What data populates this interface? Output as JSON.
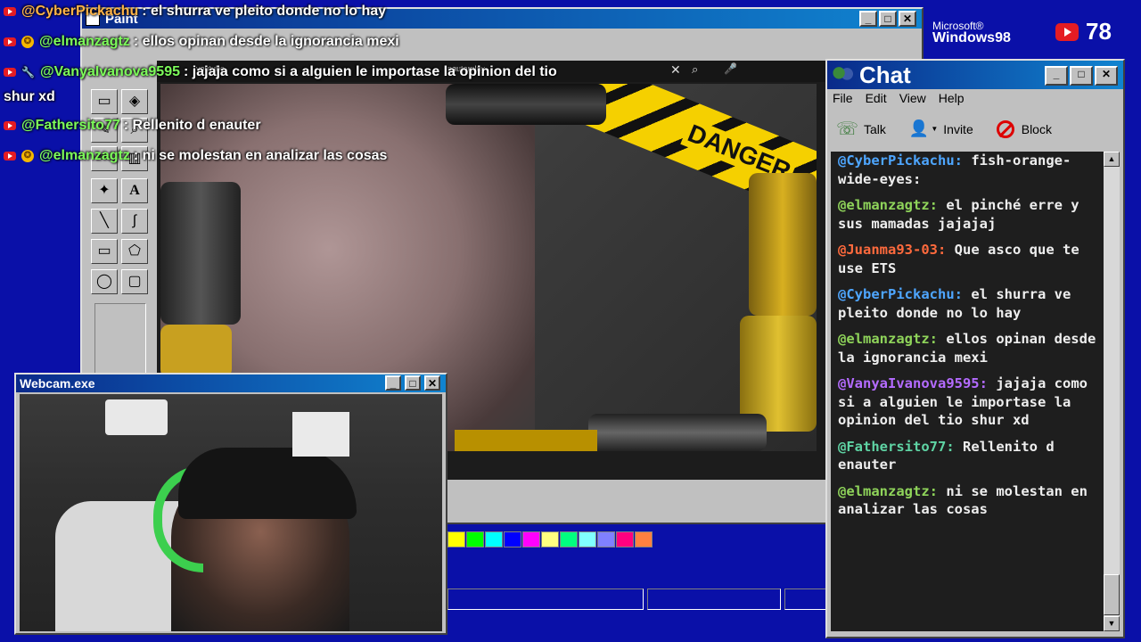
{
  "overlay_chat": [
    {
      "user": "@CyberPickachu",
      "text": ": el shurra ve pleito donde no lo hay",
      "badge": "yt",
      "color": "#ffb347"
    },
    {
      "user": "@elmanzagtz",
      "text": ": ellos opinan desde la ignorancia mexi",
      "badge": "yt-star",
      "color": "#7CFC5A"
    },
    {
      "user": "@VanyaIvanova9595",
      "text": ": jajaja como si a alguien le importase la opinion del tio",
      "badge": "yt-wrench",
      "color": "#7CFC5A"
    },
    {
      "user": "",
      "text": "shur xd",
      "badge": "",
      "color": "#ffffff"
    },
    {
      "user": "@Fathersito77",
      "text": ": Rellenito d enauter",
      "badge": "yt",
      "color": "#7CFC5A"
    },
    {
      "user": "@elmanzagtz",
      "text": ": ni se molestan en analizar las cosas",
      "badge": "yt-star",
      "color": "#7CFC5A"
    }
  ],
  "branding": {
    "os_logo_top": "Microsoft®",
    "os_logo_bottom": "Windows98",
    "viewer_count": "78"
  },
  "paint": {
    "title": "Paint",
    "video_tab_left": "youtube",
    "video_tab_right": "nauterplay",
    "danger_label": "DANGER",
    "palette_colors": [
      "#ffff00",
      "#00ff00",
      "#00ffff",
      "#0000ff",
      "#ff00ff",
      "#ffff80",
      "#00ff80",
      "#80ffff",
      "#8080ff",
      "#ff0080",
      "#ff8040"
    ]
  },
  "webcam": {
    "title": "Webcam.exe"
  },
  "chat": {
    "title": "Chat",
    "menu": [
      "File",
      "Edit",
      "View",
      "Help"
    ],
    "toolbar": {
      "talk": "Talk",
      "invite": "Invite",
      "block": "Block"
    },
    "messages": [
      {
        "user": "@CyberPickachu:",
        "text": "fish-orange-wide-eyes:",
        "color": "#4ea6ff"
      },
      {
        "user": "@elmanzagtz:",
        "text": "el pinché erre y sus mamadas jajajaj",
        "color": "#8fd45a"
      },
      {
        "user": "@Juanma93-03:",
        "text": "Que asco que te use ETS",
        "color": "#ff6a3d"
      },
      {
        "user": "@CyberPickachu:",
        "text": "el shurra ve pleito donde no lo hay",
        "color": "#4ea6ff"
      },
      {
        "user": "@elmanzagtz:",
        "text": "ellos opinan desde la ignorancia mexi",
        "color": "#8fd45a"
      },
      {
        "user": "@VanyaIvanova9595:",
        "text": "jajaja como si a alguien le importase la opinion del tio shur xd",
        "color": "#b46bff"
      },
      {
        "user": "@Fathersito77:",
        "text": "Rellenito d enauter",
        "color": "#5fd4a4"
      },
      {
        "user": "@elmanzagtz:",
        "text": "ni se molestan en analizar las cosas",
        "color": "#8fd45a"
      }
    ]
  }
}
